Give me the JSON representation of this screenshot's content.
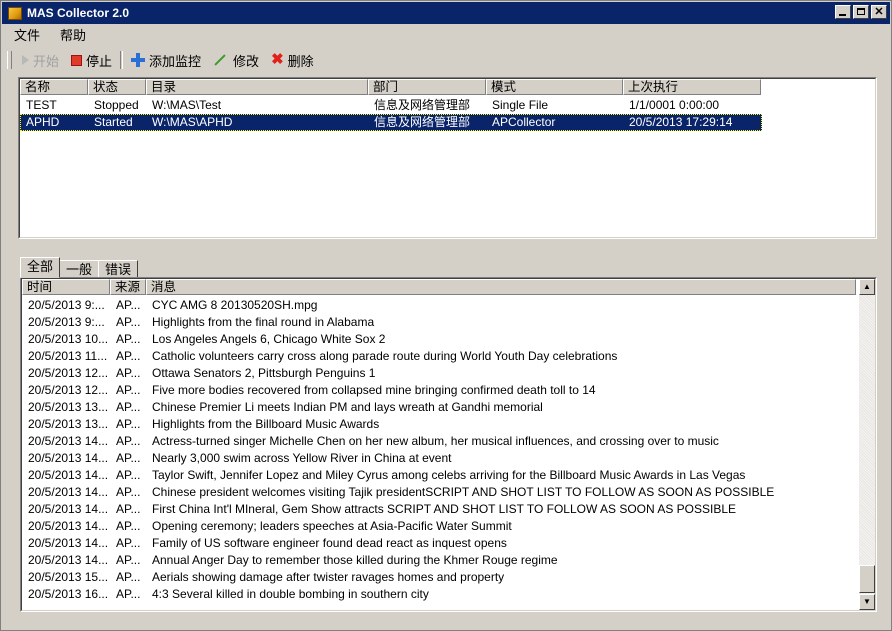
{
  "window": {
    "title": "MAS Collector 2.0"
  },
  "menu": {
    "file": "文件",
    "help": "帮助"
  },
  "toolbar": {
    "start": "开始",
    "stop": "停止",
    "add_monitor": "添加监控",
    "edit": "修改",
    "delete": "删除"
  },
  "monitors": {
    "columns": [
      "名称",
      "状态",
      "目录",
      "部门",
      "模式",
      "上次执行"
    ],
    "rows": [
      {
        "name": "TEST",
        "status": "Stopped",
        "dir": "W:\\MAS\\Test",
        "dept": "信息及网络管理部",
        "mode": "Single File",
        "last": "1/1/0001 0:00:00"
      },
      {
        "name": "APHD",
        "status": "Started",
        "dir": "W:\\MAS\\APHD",
        "dept": "信息及网络管理部",
        "mode": "APCollector",
        "last": "20/5/2013 17:29:14"
      }
    ]
  },
  "log_tabs": [
    "全部",
    "一般",
    "错误"
  ],
  "log": {
    "columns": [
      "时间",
      "来源",
      "消息"
    ],
    "rows": [
      {
        "time": "20/5/2013 9:...",
        "src": "AP...",
        "msg": "CYC AMG 8 20130520SH.mpg"
      },
      {
        "time": "20/5/2013 9:...",
        "src": "AP...",
        "msg": "Highlights from the final round in Alabama"
      },
      {
        "time": "20/5/2013 10...",
        "src": "AP...",
        "msg": "Los Angeles Angels 6, Chicago White Sox 2"
      },
      {
        "time": "20/5/2013 11...",
        "src": "AP...",
        "msg": "Catholic volunteers carry cross along parade route during  World Youth Day celebrations"
      },
      {
        "time": "20/5/2013 12...",
        "src": "AP...",
        "msg": "Ottawa Senators 2, Pittsburgh Penguins 1"
      },
      {
        "time": "20/5/2013 12...",
        "src": "AP...",
        "msg": "Five more bodies recovered from collapsed mine bringing confirmed death toll to 14"
      },
      {
        "time": "20/5/2013 13...",
        "src": "AP...",
        "msg": "Chinese Premier Li meets Indian PM and lays wreath at Gandhi memorial"
      },
      {
        "time": "20/5/2013 13...",
        "src": "AP...",
        "msg": "Highlights from the Billboard Music Awards"
      },
      {
        "time": "20/5/2013 14...",
        "src": "AP...",
        "msg": "Actress-turned singer Michelle Chen on her new album, her musical influences, and crossing over to music"
      },
      {
        "time": "20/5/2013 14...",
        "src": "AP...",
        "msg": "Nearly 3,000 swim across Yellow River in China at event"
      },
      {
        "time": "20/5/2013 14...",
        "src": "AP...",
        "msg": "Taylor Swift, Jennifer Lopez and Miley Cyrus among celebs arriving for the Billboard Music Awards in Las Vegas"
      },
      {
        "time": "20/5/2013 14...",
        "src": "AP...",
        "msg": "Chinese president welcomes visiting Tajik presidentSCRIPT AND SHOT LIST TO FOLLOW AS SOON AS POSSIBLE"
      },
      {
        "time": "20/5/2013 14...",
        "src": "AP...",
        "msg": "First China Int'l MIneral, Gem Show attracts SCRIPT AND SHOT LIST TO FOLLOW AS SOON AS POSSIBLE"
      },
      {
        "time": "20/5/2013 14...",
        "src": "AP...",
        "msg": "Opening ceremony; leaders speeches at Asia-Pacific Water Summit"
      },
      {
        "time": "20/5/2013 14...",
        "src": "AP...",
        "msg": "Family of US software engineer found dead react as inquest opens"
      },
      {
        "time": "20/5/2013 14...",
        "src": "AP...",
        "msg": "Annual Anger Day to remember those killed during the Khmer Rouge regime"
      },
      {
        "time": "20/5/2013 15...",
        "src": "AP...",
        "msg": "Aerials showing damage after twister ravages homes and property"
      },
      {
        "time": "20/5/2013 16...",
        "src": "AP...",
        "msg": "4:3 Several killed in double bombing in southern city"
      }
    ]
  }
}
